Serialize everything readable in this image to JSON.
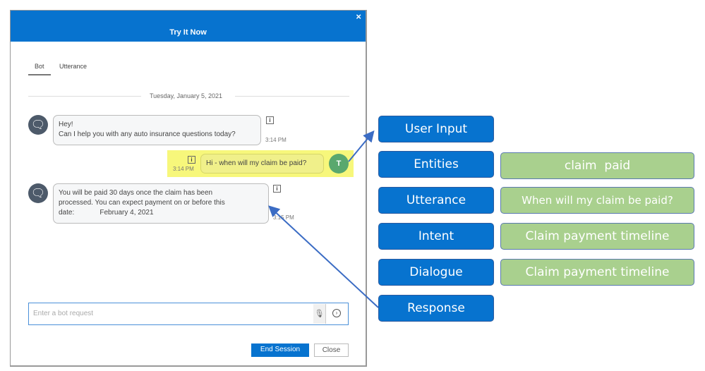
{
  "dialog": {
    "title": "Try It Now",
    "close_glyph": "×",
    "tabs": [
      {
        "label": "Bot",
        "active": true
      },
      {
        "label": "Utterance",
        "active": false
      }
    ],
    "date": "Tuesday, January 5, 2021",
    "messages": [
      {
        "from": "bot",
        "lines": [
          "Hey!",
          "Can I help you with any auto insurance questions today?"
        ],
        "time": "3:14 PM"
      },
      {
        "from": "user",
        "text": "Hi - when will my claim be paid?",
        "time": "3:14 PM",
        "avatar": "T"
      },
      {
        "from": "bot",
        "lines": [
          "You will be paid 30 days once the claim has been",
          "processed.  You can expect payment on or before this",
          "date:             February 4, 2021"
        ],
        "time": "3:15 PM"
      }
    ],
    "input_placeholder": "Enter a bot request",
    "end_session": "End Session",
    "close": "Close"
  },
  "annotations": {
    "labels": [
      "User Input",
      "Entities",
      "Utterance",
      "Intent",
      "Dialogue",
      "Response"
    ],
    "values": {
      "entities": "claim  paid",
      "utterance": "When will my claim be paid?",
      "intent": "Claim payment timeline",
      "dialogue": "Claim payment timeline"
    }
  },
  "colors": {
    "primary": "#0773cf",
    "green": "#a9d08e",
    "highlight": "#f7f77b",
    "user_avatar": "#5aa86e"
  }
}
